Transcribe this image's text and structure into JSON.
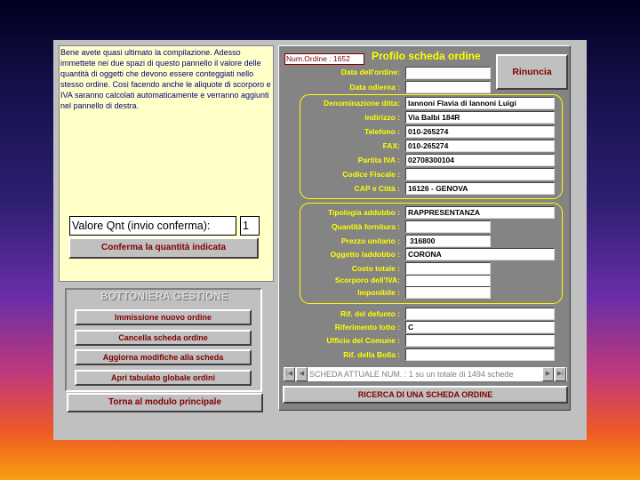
{
  "left": {
    "info_text": "Bene avete quasi ultimato la compilazione. Adesso immettete nei due spazi di questo pannello il valore delle quantità di oggetti che devono essere conteggiati nello stesso ordine. Così facendo anche le aliquote di scorporo e IVA saranno calcolati automaticamente e verranno aggiunti nel pannello di destra.",
    "qty_label": "Valore Qnt (invio conferma):",
    "qty_value": "1",
    "confirm_button": "Conferma la quantità indicata"
  },
  "management": {
    "title": "BOTTONIERA GESTIONE",
    "buttons": [
      "Immissione nuovo ordine",
      "Cancella scheda ordine",
      "Aggiorna modifiche alla scheda",
      "Apri tabulato globale ordini"
    ],
    "main_button": "Torna al modulo principale"
  },
  "profile": {
    "order_number": "Num.Ordine : 1652",
    "title": "Profilo scheda ordine",
    "cancel_button": "Rinuncia",
    "date_fields": [
      {
        "label": "Data dell'ordine:",
        "value": ""
      },
      {
        "label": "Data odierna :",
        "value": ""
      }
    ],
    "company_fields": [
      {
        "label": "Denominazione ditta:",
        "value": "Iannoni Flavia di Iannoni Luigi"
      },
      {
        "label": "Indirizzo :",
        "value": "Via Balbi 184R"
      },
      {
        "label": "Telefono :",
        "value": "010-265274"
      },
      {
        "label": "FAX:",
        "value": "010-265274"
      },
      {
        "label": "Partita IVA :",
        "value": "02708300104"
      },
      {
        "label": "Codice Fiscale :",
        "value": ""
      },
      {
        "label": "CAP e Città :",
        "value": "16126 - GENOVA"
      }
    ],
    "item_fields": [
      {
        "label": "Tipologia addobbo :",
        "value": "RAPPRESENTANZA"
      },
      {
        "label": "Quantità fornitura :",
        "value": ""
      },
      {
        "label": "Prezzo unitario :",
        "value": "316800"
      },
      {
        "label": "Oggetto /addobbo :",
        "value": "CORONA"
      },
      {
        "label": "Costo totale :",
        "value": ""
      },
      {
        "label": "Scorporo dell'IVA:",
        "value": ""
      },
      {
        "label": "Imponibile :",
        "value": ""
      }
    ],
    "extra_fields": [
      {
        "label": "Rif. del defunto :",
        "value": ""
      },
      {
        "label": "Riferimento lotto :",
        "value": "C"
      },
      {
        "label": "Ufficio del Comune :",
        "value": ""
      },
      {
        "label": "Rif. della Bolla :",
        "value": ""
      }
    ],
    "nav_text": "SCHEDA ATTUALE NUM. : 1 su un totale di  1494 schede",
    "search_button": "RICERCA DI UNA SCHEDA ORDINE"
  },
  "icons": {
    "first": "first-record-icon",
    "prev": "previous-record-icon",
    "next": "next-record-icon",
    "last": "last-record-icon"
  },
  "colors": {
    "label": "#ffff00",
    "button_text": "#800000",
    "info_text": "#000080",
    "panel": "#848484"
  }
}
